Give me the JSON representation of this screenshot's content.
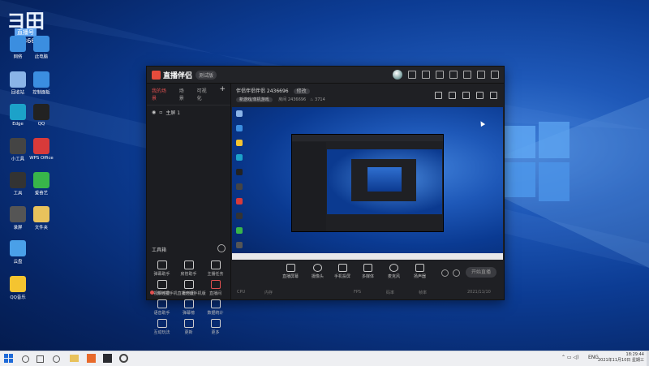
{
  "desktop": {
    "sticker": {
      "big": "ヨ田",
      "sub": "直播号",
      "number": "2436696"
    },
    "icons": [
      {
        "label": "网络",
        "color": "#3b8ee0"
      },
      {
        "label": "此电脑",
        "color": "#3b8ee0"
      },
      {
        "label": "回收站",
        "color": "#8ab4e8"
      },
      {
        "label": "控制面板",
        "color": "#3b8ee0"
      },
      {
        "label": "Edge",
        "color": "#1ca2c9"
      },
      {
        "label": "QQ",
        "color": "#222222"
      },
      {
        "label": "小工具",
        "color": "#444444"
      },
      {
        "label": "WPS Office",
        "color": "#d83a3a"
      },
      {
        "label": "工具",
        "color": "#333333"
      },
      {
        "label": "爱奇艺",
        "color": "#38b54a"
      },
      {
        "label": "录屏",
        "color": "#555555"
      },
      {
        "label": "文件夹",
        "color": "#e8c25c"
      },
      {
        "label": "云盘",
        "color": "#4aa0e8"
      },
      {
        "label": "QQ音乐",
        "color": "#f4c430"
      }
    ]
  },
  "app": {
    "title": "直播伴侣",
    "version": "测试版",
    "tabs": [
      "我的场景",
      "场景",
      "可视化"
    ],
    "scene_label": "主屏 1",
    "tools_heading": "工具箱",
    "tools": [
      "弹幕助手",
      "房管助手",
      "主播任务",
      "视频连麦",
      "粉丝团",
      "直播间",
      "语音助手",
      "弹幕榜",
      "数据统计",
      "互动玩法",
      "更新",
      "更多"
    ],
    "notice": "你可把手机直播开启手机版",
    "stream": {
      "title": "伴侣伴侣伴侣 2436696",
      "title_pill": "修改",
      "category": "新游戏/单机游戏",
      "room_label": "房间",
      "room_id": "2436696",
      "viewers": "3714"
    },
    "controls": [
      "直播屏幕",
      "摄像头",
      "手机投屏",
      "多媒体",
      "麦克风",
      "扬声器"
    ],
    "go_live": "开始直播",
    "status": [
      "CPU",
      "内存",
      "FPS",
      "码率",
      "帧率",
      "2021/11/10"
    ]
  },
  "taskbar": {
    "lang": "ENG",
    "time": "18:29:44",
    "date": "2021年11月10日 星期三"
  }
}
